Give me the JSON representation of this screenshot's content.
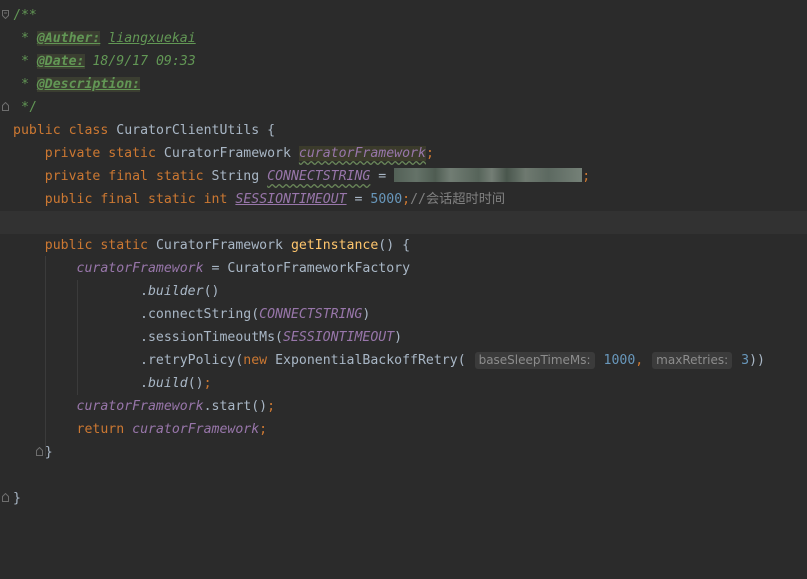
{
  "comment": {
    "open": "/**",
    "star": "*",
    "close": "*/",
    "tags": [
      {
        "tag": "@Auther:",
        "value": "liangxuekai"
      },
      {
        "tag": "@Date:",
        "value": "18/9/17 09:33"
      },
      {
        "tag": "@Description:",
        "value": ""
      }
    ]
  },
  "code": {
    "kw_public": "public",
    "kw_private": "private",
    "kw_static": "static",
    "kw_final": "final",
    "kw_class": "class",
    "kw_int": "int",
    "kw_new": "new",
    "kw_return": "return",
    "class_name": "CuratorClientUtils",
    "type_framework": "CuratorFramework",
    "type_string": "String",
    "field_framework": "curatorFramework",
    "field_connect": "CONNECTSTRING",
    "field_timeout": "SESSIONTIMEOUT",
    "timeout_value": "5000",
    "timeout_comment": "//会话超时时间",
    "method_getinstance": "getInstance",
    "factory": "CuratorFrameworkFactory",
    "builder": "builder",
    "connect_string": "connectString",
    "session_timeout_ms": "sessionTimeoutMs",
    "retry_policy": "retryPolicy",
    "retry_class": "ExponentialBackoffRetry",
    "hint_base_sleep": "baseSleepTimeMs:",
    "base_sleep_value": "1000",
    "hint_max_retries": "maxRetries:",
    "max_retries_value": "3",
    "build": "build",
    "start": "start"
  },
  "colors": {
    "background": "#2b2b2b",
    "keyword": "#cc7832",
    "field": "#9876aa",
    "number": "#6897bb",
    "method_decl": "#ffc66d",
    "doc_comment": "#629755",
    "line_comment": "#808080",
    "default_text": "#a9b7c6"
  }
}
